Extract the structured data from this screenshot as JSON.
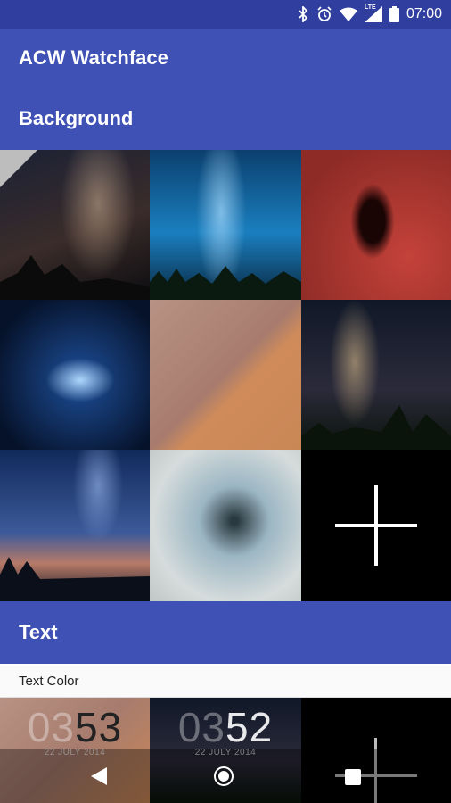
{
  "status": {
    "time": "07:00",
    "network": "LTE"
  },
  "appbar": {
    "title": "ACW Watchface",
    "section": "Background"
  },
  "backgrounds": [
    {
      "name": "milky-way-tree",
      "selected": true
    },
    {
      "name": "milky-way-forest"
    },
    {
      "name": "nebula-red"
    },
    {
      "name": "boomerang-nebula"
    },
    {
      "name": "mars-terrain"
    },
    {
      "name": "milky-way-trees-2"
    },
    {
      "name": "milky-way-lake"
    },
    {
      "name": "crater-burst"
    },
    {
      "name": "add-background"
    }
  ],
  "text_section": {
    "title": "Text",
    "color_label": "Text Color"
  },
  "previews": [
    {
      "dim": "03",
      "bright": "53",
      "date": "22 JULY 2014"
    },
    {
      "dim": "03",
      "bright": "52",
      "date": "22 JULY 2014"
    }
  ],
  "icons": {
    "bluetooth": "bluetooth-icon",
    "alarm": "alarm-icon",
    "wifi": "wifi-icon",
    "signal": "signal-icon",
    "battery": "battery-icon",
    "back": "back-icon",
    "home": "home-icon",
    "recents": "recents-icon",
    "add": "plus-icon"
  },
  "colors": {
    "primary": "#3f51b5",
    "primary_dark": "#303f9f"
  }
}
